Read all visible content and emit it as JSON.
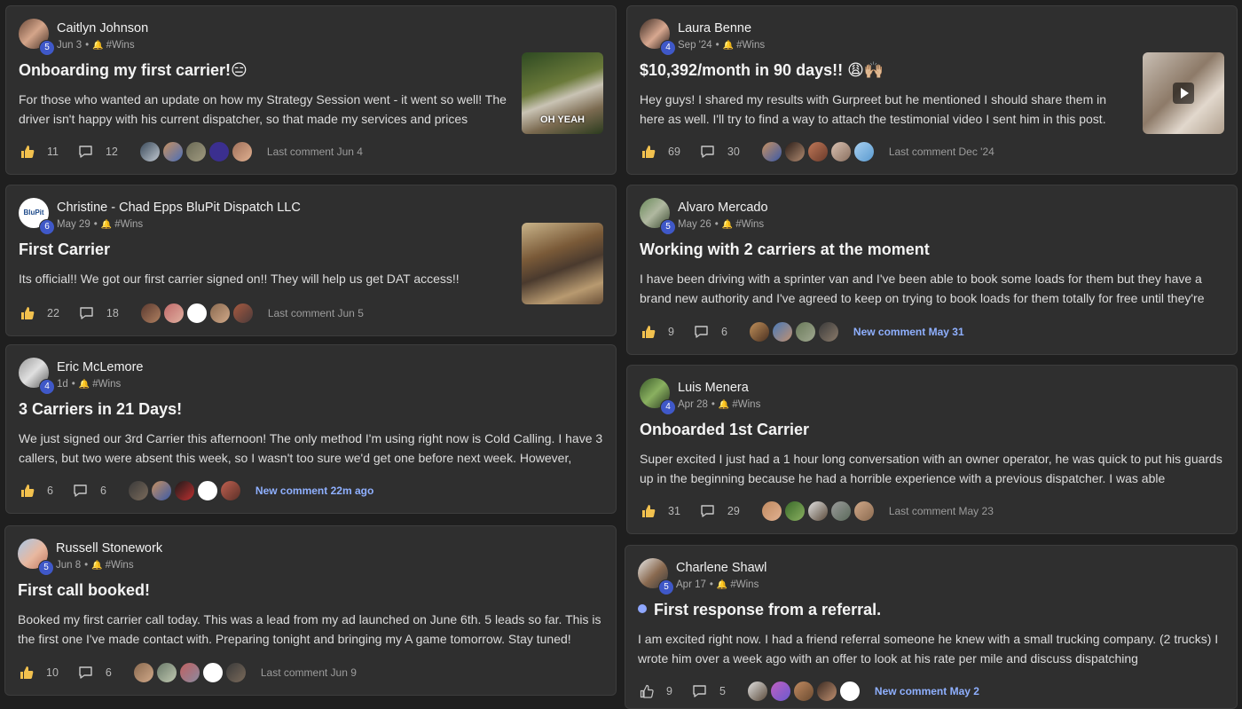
{
  "colors": {
    "background": "#1f1f1f",
    "card": "#2f2f2f",
    "level_badge": "#3f58c8",
    "new_comment": "#8fb0ff",
    "bell": "#f2b835"
  },
  "posts": [
    {
      "author": "Caitlyn Johnson",
      "level": "5",
      "date": "Jun 3",
      "category": "#Wins",
      "title": "Onboarding my first carrier!😑",
      "body": "For those who wanted an update on how my Strategy Session went - it went so well! The driver isn't happy with his current dispatcher, so that made my services and prices",
      "likes": "11",
      "comments": "12",
      "activity": "Last comment Jun 4",
      "thumb_caption": "OH YEAH"
    },
    {
      "author": "Laura Benne",
      "level": "4",
      "date": "Sep '24",
      "category": "#Wins",
      "title": "$10,392/month in 90 days!! 😩🙌🏼",
      "body": "Hey guys! I shared my results with Gurpreet but he mentioned I should share them in here as well. I'll try to find a way to attach the testimonial video I sent him in this post.",
      "likes": "69",
      "comments": "30",
      "activity": "Last comment Dec '24"
    },
    {
      "author": "Christine - Chad Epps BluPit Dispatch LLC",
      "level": "6",
      "date": "May 29",
      "category": "#Wins",
      "title": "First Carrier",
      "body": "Its official!! We got our first carrier signed on!! They will help us get DAT access!!",
      "likes": "22",
      "comments": "18",
      "activity": "Last comment Jun 5",
      "avatar_text": "BluPit"
    },
    {
      "author": "Alvaro Mercado",
      "level": "5",
      "date": "May 26",
      "category": "#Wins",
      "title": "Working with 2 carriers at the moment",
      "body": "I have been driving with a sprinter van and I've been able to book some loads for them but they have a brand new authority and I've agreed to keep on trying to book loads for them totally for free until they're",
      "likes": "9",
      "comments": "6",
      "activity": "New comment May 31"
    },
    {
      "author": "Eric McLemore",
      "level": "4",
      "date": "1d",
      "category": "#Wins",
      "title": "3 Carriers in 21 Days!",
      "body": "We just signed our 3rd Carrier this afternoon! The only method I'm using right now is Cold Calling. I have 3 callers, but two were absent this week, so I wasn't too sure we'd get one before next week. However,",
      "likes": "6",
      "comments": "6",
      "activity": "New comment 22m ago"
    },
    {
      "author": "Luis Menera",
      "level": "4",
      "date": "Apr 28",
      "category": "#Wins",
      "title": "Onboarded 1st Carrier",
      "body": "Super excited I just had a 1 hour long conversation with an owner operator, he was quick to put his guards up in the beginning because he had a horrible experience with a previous dispatcher. I was able",
      "likes": "31",
      "comments": "29",
      "activity": "Last comment May 23"
    },
    {
      "author": "Russell Stonework",
      "level": "5",
      "date": "Jun 8",
      "category": "#Wins",
      "title": "First call booked!",
      "body": "Booked my first carrier call today. This was a lead from my ad launched on June 6th. 5 leads so far. This is the first one I've made contact with. Preparing tonight and bringing my A game tomorrow. Stay tuned!",
      "likes": "10",
      "comments": "6",
      "activity": "Last comment Jun 9"
    },
    {
      "author": "Charlene Shawl",
      "level": "5",
      "date": "Apr 17",
      "category": "#Wins",
      "title": "First response from a referral.",
      "body": "I am excited right now. I had a friend referral someone he knew with a small trucking company. (2 trucks) I wrote him over a week ago with an offer to look at his rate per mile and discuss dispatching",
      "likes": "9",
      "comments": "5",
      "activity": "New comment May 2"
    }
  ]
}
